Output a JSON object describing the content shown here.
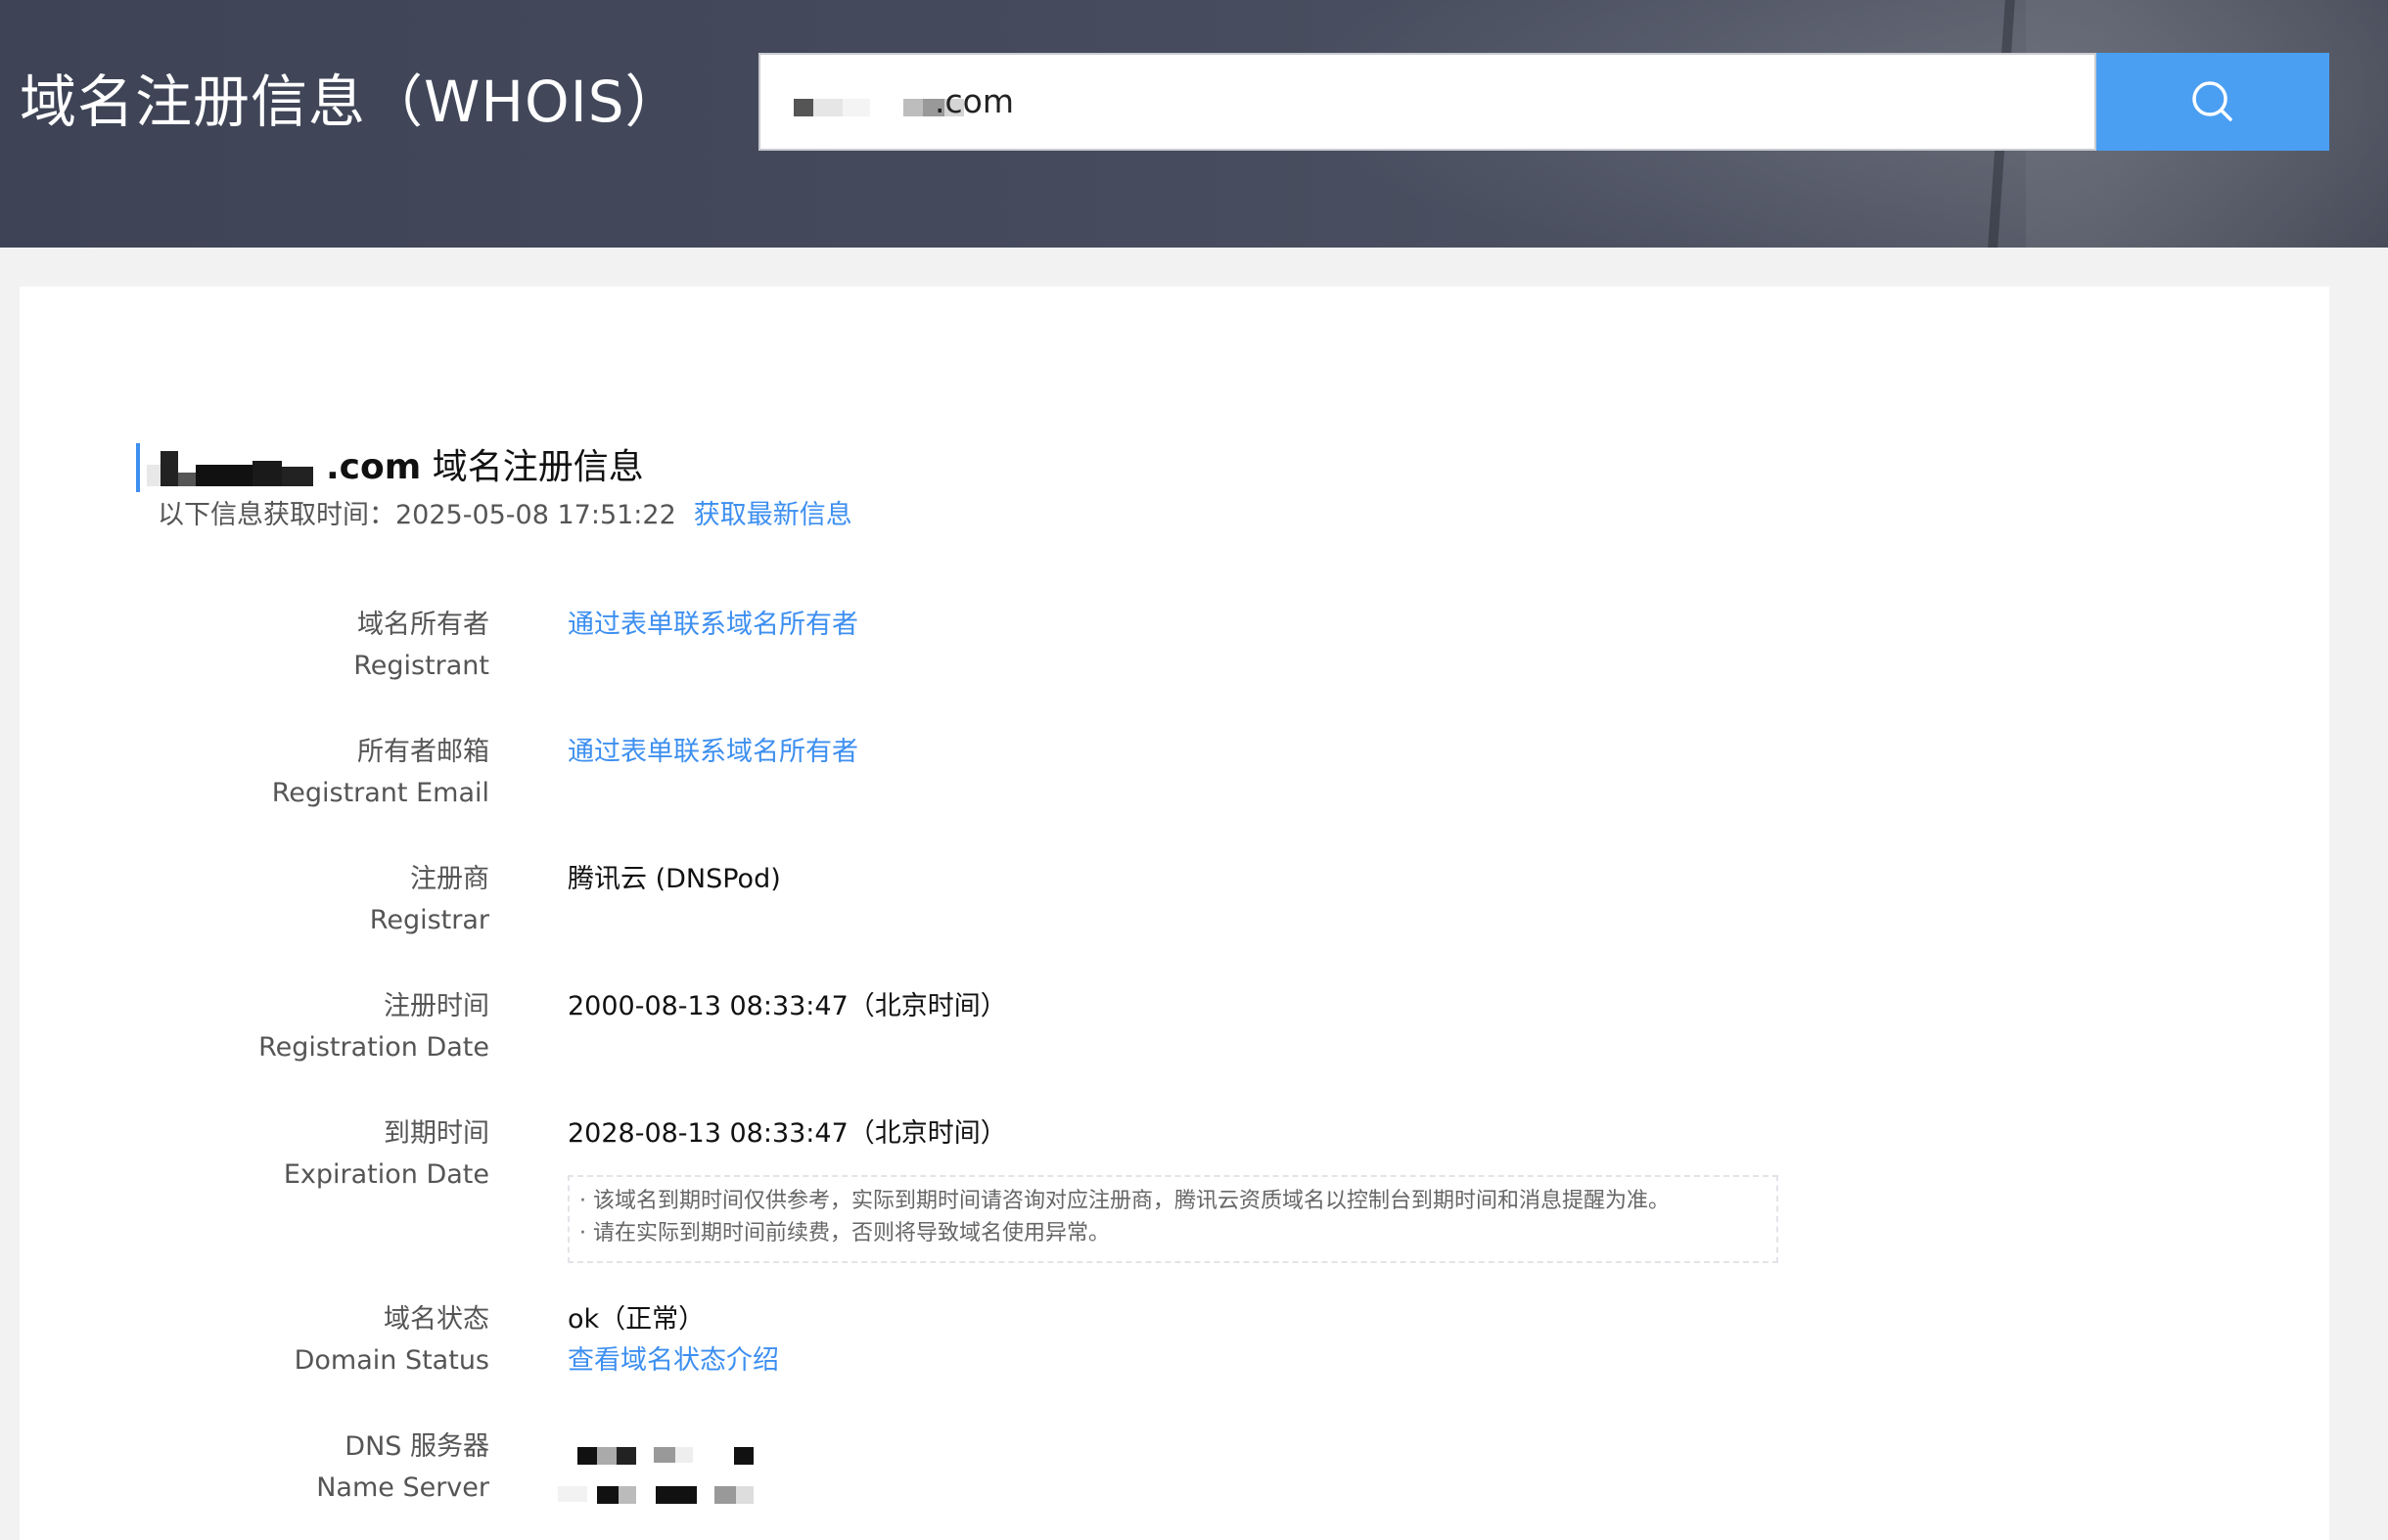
{
  "header": {
    "title": "域名注册信息（WHOIS）",
    "search_value": ".com",
    "search_icon": "search-icon"
  },
  "section": {
    "domain_tld": ".com",
    "title_suffix": " 域名注册信息",
    "fetch_label": "以下信息获取时间：",
    "fetch_time": "2025-05-08 17:51:22",
    "refresh_link": "获取最新信息"
  },
  "rows": {
    "registrant": {
      "label_cn": "域名所有者",
      "label_en": "Registrant",
      "value": "通过表单联系域名所有者"
    },
    "registrant_email": {
      "label_cn": "所有者邮箱",
      "label_en": "Registrant Email",
      "value": "通过表单联系域名所有者"
    },
    "registrar": {
      "label_cn": "注册商",
      "label_en": "Registrar",
      "value": "腾讯云 (DNSPod)"
    },
    "registration_date": {
      "label_cn": "注册时间",
      "label_en": "Registration Date",
      "value": "2000-08-13 08:33:47（北京时间）"
    },
    "expiration_date": {
      "label_cn": "到期时间",
      "label_en": "Expiration Date",
      "value": "2028-08-13 08:33:47（北京时间）",
      "notice_1": "· 该域名到期时间仅供参考，实际到期时间请咨询对应注册商，腾讯云资质域名以控制台到期时间和消息提醒为准。",
      "notice_2": "· 请在实际到期时间前续费，否则将导致域名使用异常。"
    },
    "domain_status": {
      "label_cn": "域名状态",
      "label_en": "Domain Status",
      "value": "ok（正常）",
      "link": "查看域名状态介绍"
    },
    "name_server": {
      "label_cn": "DNS 服务器",
      "label_en": "Name Server"
    }
  },
  "colors": {
    "accent": "#4a9ff3",
    "link": "#3d8ff0",
    "header_bg": "#454b5d"
  }
}
